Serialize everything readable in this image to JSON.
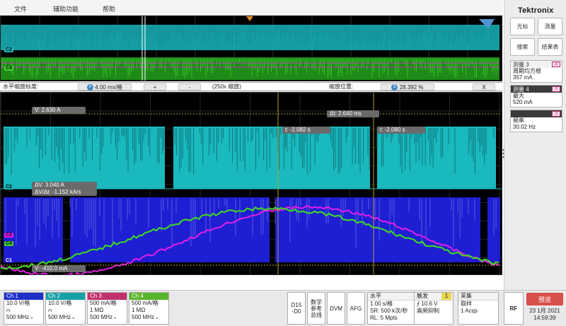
{
  "menu": [
    "文件",
    "辅助功能",
    "帮助"
  ],
  "brand": "Tektronix",
  "right_buttons": [
    "光标",
    "测量",
    "搜索",
    "结果表"
  ],
  "measurements": [
    {
      "title": "测量 3",
      "badge": "3",
      "lines": [
        "周期均方根",
        "357 mA"
      ]
    },
    {
      "title": "测量 4",
      "badge": "3",
      "lines": [
        "最大",
        "520 mA"
      ]
    },
    {
      "title": "",
      "badge": "3",
      "lines": [
        "频率",
        "30.02 Hz"
      ]
    }
  ],
  "overview_labels": [
    "C2",
    "C4"
  ],
  "zoom": {
    "label": "水平缩放标度:",
    "icon": "A",
    "scale": "4.00 ms/格",
    "plus": "+",
    "minus": "-",
    "factor": "(250x 缩放)",
    "pos_label": "缩放位置:",
    "pos_icon": "B",
    "pos_value": "28.392 %",
    "close": "X"
  },
  "readouts": {
    "v_top": "V:   2.630  A",
    "delta_t": "Δt:  2.640  ms",
    "t1": "t:   -2.082  s",
    "t2": "t:   -2.080  s",
    "delta_v": "ΔV:        3.040  A",
    "dv_dt": "ΔV/Δt:  -1.152 kA/s",
    "v_bottom": "V:   -410.0 mA"
  },
  "wave_labels": [
    "C2",
    "C3",
    "C4",
    "C1"
  ],
  "colors": {
    "ch1": "#1e1ed2",
    "ch2": "#19b9be",
    "ch3": "#e61ee6",
    "ch4": "#3ed22a",
    "cursor": "#b4a028"
  },
  "channels": [
    {
      "name": "Ch 1",
      "color": "#1e2fc8",
      "lines": [
        "10.0 V/格",
        "⩀",
        "500 MHz ₙ"
      ]
    },
    {
      "name": "Ch 2",
      "color": "#16a0a8",
      "lines": [
        "10.0 V/格",
        "⩀",
        "500 MHz ₙ"
      ]
    },
    {
      "name": "Ch 3",
      "color": "#c0306e",
      "lines": [
        "500 mA/格",
        "1 MΩ",
        "500 MHz ₙ"
      ]
    },
    {
      "name": "Ch 4",
      "color": "#58b428",
      "lines": [
        "500 mA/格",
        "1 MΩ",
        "500 MHz ₙ"
      ]
    }
  ],
  "bottom": {
    "d15": "D15\n-D0",
    "ref": "数学\n参考\n总线",
    "dvm": "DVM",
    "afg": "AFG",
    "horiz_title": "水平",
    "horiz_lines": [
      "1.00 s/格",
      "SR: 500 k次/秒",
      "RL: 5 Mpts"
    ],
    "trig_title": "触发",
    "trig_badge": "1",
    "trig_lines": [
      "⨍   10.6 V",
      "高频抑制"
    ],
    "acq_title": "采集",
    "acq_lines": [
      "取样",
      "1 Acqs"
    ],
    "rf": "RF",
    "preview": "预览",
    "date": "23 1月 2021",
    "time": "14:59:39"
  }
}
